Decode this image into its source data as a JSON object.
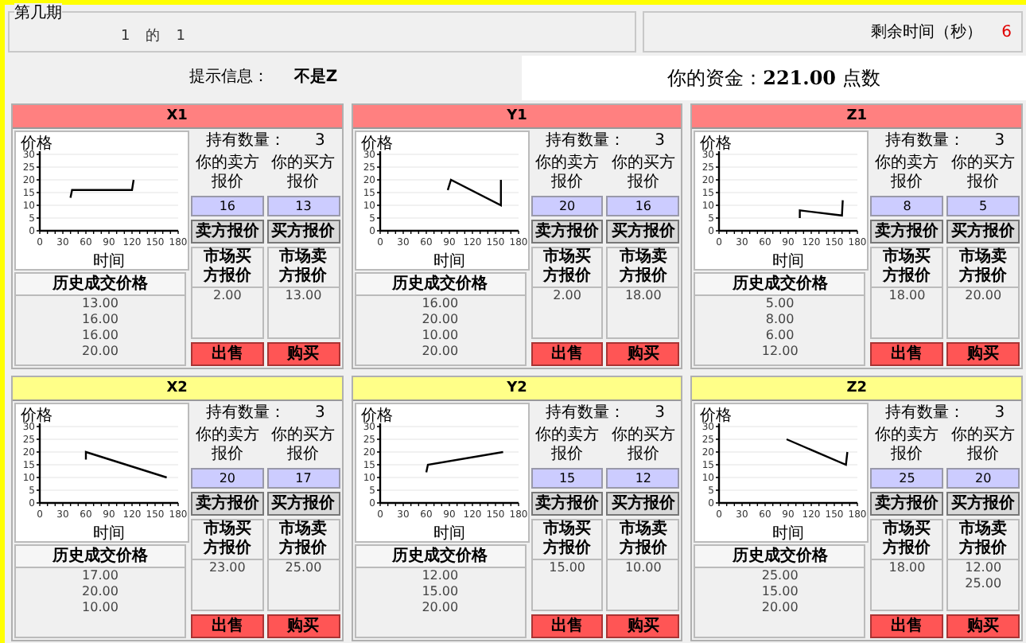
{
  "round_box": {
    "legend": "第几期",
    "progress": [
      "1",
      "的",
      "1"
    ]
  },
  "timer": {
    "label": "剩余时间（秒）",
    "value": "6"
  },
  "hint": {
    "label": "提示信息：",
    "value": "不是Z"
  },
  "funds": "你的资金：**221.00** 点数",
  "markets": [
    {
      "title": "X1",
      "color": "#ff8080",
      "quantity_label": "持有数量：",
      "quantity": "3",
      "sell_label": "你的卖方报价",
      "buy_label": "你的买方报价",
      "sell_price": "16",
      "buy_price": "13",
      "sell_button": "卖方报价",
      "buy_button": "买方报价",
      "bid_header": "市场买方报价",
      "ask_header": "市场卖方报价",
      "bids": [
        "2.00"
      ],
      "asks": [
        "13.00"
      ],
      "history_header": "历史成交价格",
      "history": [
        "13.00",
        "16.00",
        "16.00",
        "20.00"
      ],
      "sell_action": "出售",
      "buy_action": "购买",
      "chart_data": {
        "type": "line",
        "xlabel": "时间",
        "ylabel": "价格",
        "grid": true,
        "x": [
          40,
          42,
          120,
          122
        ],
        "series": [
          {
            "values": [
              13,
              16,
              16,
              20
            ]
          }
        ],
        "xlim": [
          0,
          180
        ],
        "ylim": [
          0,
          30
        ],
        "xticks": [
          0,
          30,
          60,
          90,
          120,
          150,
          180
        ],
        "yticks": [
          0,
          5,
          10,
          15,
          20,
          25,
          30
        ]
      }
    },
    {
      "title": "Y1",
      "color": "#ff8080",
      "quantity_label": "持有数量：",
      "quantity": "3",
      "sell_label": "你的卖方报价",
      "buy_label": "你的买方报价",
      "sell_price": "20",
      "buy_price": "16",
      "sell_button": "卖方报价",
      "buy_button": "买方报价",
      "bid_header": "市场买方报价",
      "ask_header": "市场卖方报价",
      "bids": [
        "2.00"
      ],
      "asks": [
        "18.00"
      ],
      "history_header": "历史成交价格",
      "history": [
        "16.00",
        "20.00",
        "10.00",
        "20.00"
      ],
      "sell_action": "出售",
      "buy_action": "购买",
      "chart_data": {
        "type": "line",
        "xlabel": "时间",
        "ylabel": "价格",
        "grid": true,
        "x": [
          88,
          92,
          157,
          157
        ],
        "series": [
          {
            "values": [
              16,
              20,
              10,
              20
            ]
          }
        ],
        "xlim": [
          0,
          180
        ],
        "ylim": [
          0,
          30
        ],
        "xticks": [
          0,
          30,
          60,
          90,
          120,
          150,
          180
        ],
        "yticks": [
          0,
          5,
          10,
          15,
          20,
          25,
          30
        ]
      }
    },
    {
      "title": "Z1",
      "color": "#ff8080",
      "quantity_label": "持有数量：",
      "quantity": "3",
      "sell_label": "你的卖方报价",
      "buy_label": "你的买方报价",
      "sell_price": "8",
      "buy_price": "5",
      "sell_button": "卖方报价",
      "buy_button": "买方报价",
      "bid_header": "市场买方报价",
      "ask_header": "市场卖方报价",
      "bids": [
        "18.00"
      ],
      "asks": [
        "20.00"
      ],
      "history_header": "历史成交价格",
      "history": [
        "5.00",
        "8.00",
        "6.00",
        "12.00"
      ],
      "sell_action": "出售",
      "buy_action": "购买",
      "chart_data": {
        "type": "line",
        "xlabel": "时间",
        "ylabel": "价格",
        "grid": true,
        "x": [
          105,
          105,
          160,
          161
        ],
        "series": [
          {
            "values": [
              5,
              8,
              6,
              12
            ]
          }
        ],
        "xlim": [
          0,
          180
        ],
        "ylim": [
          0,
          30
        ],
        "xticks": [
          0,
          30,
          60,
          90,
          120,
          150,
          180
        ],
        "yticks": [
          0,
          5,
          10,
          15,
          20,
          25,
          30
        ]
      }
    },
    {
      "title": "X2",
      "color": "#ffff88",
      "quantity_label": "持有数量：",
      "quantity": "3",
      "sell_label": "你的卖方报价",
      "buy_label": "你的买方报价",
      "sell_price": "20",
      "buy_price": "17",
      "sell_button": "卖方报价",
      "buy_button": "买方报价",
      "bid_header": "市场买方报价",
      "ask_header": "市场卖方报价",
      "bids": [
        "23.00"
      ],
      "asks": [
        "25.00"
      ],
      "history_header": "历史成交价格",
      "history": [
        "17.00",
        "20.00",
        "10.00"
      ],
      "sell_action": "出售",
      "buy_action": "购买",
      "chart_data": {
        "type": "line",
        "xlabel": "时间",
        "ylabel": "价格",
        "grid": true,
        "x": [
          60,
          60,
          165
        ],
        "series": [
          {
            "values": [
              17,
              20,
              10
            ]
          }
        ],
        "xlim": [
          0,
          180
        ],
        "ylim": [
          0,
          30
        ],
        "xticks": [
          0,
          30,
          60,
          90,
          120,
          150,
          180
        ],
        "yticks": [
          0,
          5,
          10,
          15,
          20,
          25,
          30
        ]
      }
    },
    {
      "title": "Y2",
      "color": "#ffff88",
      "quantity_label": "持有数量：",
      "quantity": "3",
      "sell_label": "你的卖方报价",
      "buy_label": "你的买方报价",
      "sell_price": "15",
      "buy_price": "12",
      "sell_button": "卖方报价",
      "buy_button": "买方报价",
      "bid_header": "市场买方报价",
      "ask_header": "市场卖方报价",
      "bids": [
        "15.00"
      ],
      "asks": [
        "10.00"
      ],
      "history_header": "历史成交价格",
      "history": [
        "12.00",
        "15.00",
        "20.00"
      ],
      "sell_action": "出售",
      "buy_action": "购买",
      "chart_data": {
        "type": "line",
        "xlabel": "时间",
        "ylabel": "价格",
        "grid": true,
        "x": [
          60,
          62,
          160
        ],
        "series": [
          {
            "values": [
              12,
              15,
              20
            ]
          }
        ],
        "xlim": [
          0,
          180
        ],
        "ylim": [
          0,
          30
        ],
        "xticks": [
          0,
          30,
          60,
          90,
          120,
          150,
          180
        ],
        "yticks": [
          0,
          5,
          10,
          15,
          20,
          25,
          30
        ]
      }
    },
    {
      "title": "Z2",
      "color": "#ffff88",
      "quantity_label": "持有数量：",
      "quantity": "3",
      "sell_label": "你的卖方报价",
      "buy_label": "你的买方报价",
      "sell_price": "25",
      "buy_price": "20",
      "sell_button": "卖方报价",
      "buy_button": "买方报价",
      "bid_header": "市场买方报价",
      "ask_header": "市场卖方报价",
      "bids": [
        "18.00"
      ],
      "asks": [
        "12.00",
        "25.00"
      ],
      "history_header": "历史成交价格",
      "history": [
        "25.00",
        "15.00",
        "20.00"
      ],
      "sell_action": "出售",
      "buy_action": "购买",
      "chart_data": {
        "type": "line",
        "xlabel": "时间",
        "ylabel": "价格",
        "grid": true,
        "x": [
          88,
          165,
          167
        ],
        "series": [
          {
            "values": [
              25,
              15,
              20
            ]
          }
        ],
        "xlim": [
          0,
          180
        ],
        "ylim": [
          0,
          30
        ],
        "xticks": [
          0,
          30,
          60,
          90,
          120,
          150,
          180
        ],
        "yticks": [
          0,
          5,
          10,
          15,
          20,
          25,
          30
        ]
      }
    }
  ]
}
